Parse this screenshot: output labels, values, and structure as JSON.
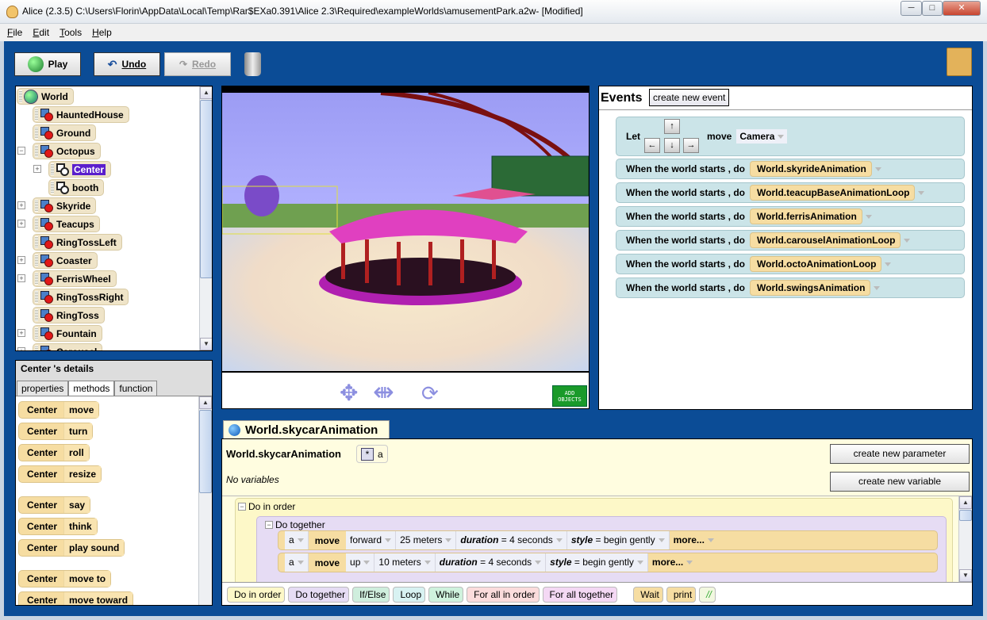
{
  "window": {
    "title": "Alice (2.3.5) C:\\Users\\Florin\\AppData\\Local\\Temp\\Rar$EXa0.391\\Alice 2.3\\Required\\exampleWorlds\\amusementPark.a2w-  [Modified]",
    "minimize": "─",
    "maximize": "□",
    "close": "✕"
  },
  "menu": [
    "File",
    "Edit",
    "Tools",
    "Help"
  ],
  "toolbar": {
    "play": "Play",
    "undo": "Undo",
    "redo": "Redo"
  },
  "tree": {
    "items": [
      {
        "label": "World",
        "icon": "world-icon"
      },
      {
        "label": "HauntedHouse"
      },
      {
        "label": "Ground"
      },
      {
        "label": "Octopus",
        "expanded": true
      },
      {
        "label": "Center",
        "selected": true
      },
      {
        "label": "booth"
      },
      {
        "label": "Skyride"
      },
      {
        "label": "Teacups"
      },
      {
        "label": "RingTossLeft"
      },
      {
        "label": "Coaster"
      },
      {
        "label": "FerrisWheel"
      },
      {
        "label": "RingTossRight"
      },
      {
        "label": "RingToss"
      },
      {
        "label": "Fountain"
      },
      {
        "label": "Carousel"
      }
    ]
  },
  "details": {
    "title": "Center 's details",
    "tabs": [
      "properties",
      "methods",
      "function"
    ],
    "active_tab": "methods",
    "object": "Center",
    "methods": [
      "move",
      "turn",
      "roll",
      "resize",
      "say",
      "think",
      "play sound",
      "move to",
      "move  toward"
    ]
  },
  "view": {
    "add_objects": "ADD OBJECTS"
  },
  "events": {
    "title": "Events",
    "create": "create new event",
    "let": "Let",
    "move": "move",
    "camera": "Camera",
    "keys": [
      "↑",
      "←",
      "↓",
      "→"
    ],
    "when": "When the world starts , do",
    "handlers": [
      "World.skyrideAnimation",
      "World.teacupBaseAnimationLoop",
      "World.ferrisAnimation",
      "World.carouselAnimationLoop",
      "World.octoAnimationLoop",
      "World.swingsAnimation"
    ]
  },
  "editor": {
    "tab": "World.skycarAnimation",
    "method": "World.skycarAnimation",
    "param": "a",
    "no_vars": "No variables",
    "new_param": "create new parameter",
    "new_var": "create new variable",
    "do_in_order": "Do in order",
    "do_together": "Do together",
    "statements": [
      {
        "obj": "a",
        "verb": "move",
        "dir": "forward",
        "amount": "25 meters",
        "duration": "= 4 seconds",
        "style": "= begin gently",
        "more": "more..."
      },
      {
        "obj": "a",
        "verb": "move",
        "dir": "up",
        "amount": "10 meters",
        "duration": "= 4 seconds",
        "style": "= begin gently",
        "more": "more..."
      }
    ],
    "duration_label": "duration",
    "style_label": "style",
    "palette": [
      "Do in order",
      "Do together",
      "If/Else",
      "Loop",
      "While",
      "For all in order",
      "For all together",
      "Wait",
      "print",
      "//"
    ]
  }
}
